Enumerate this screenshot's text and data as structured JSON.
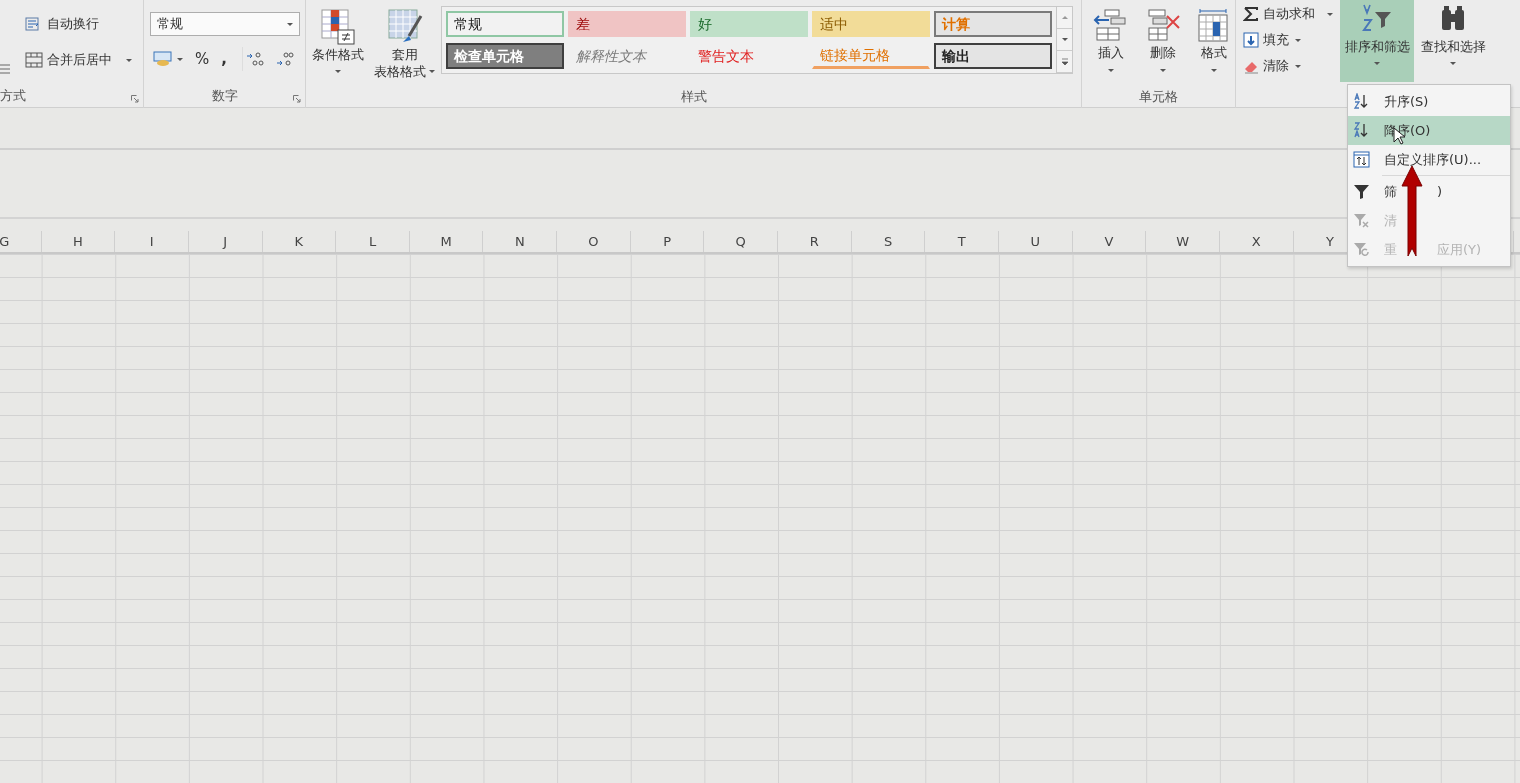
{
  "alignment_group": {
    "label": "方式",
    "wrap_text": "自动换行",
    "merge_center": "合并后居中"
  },
  "number_group": {
    "label": "数字",
    "format_value": "常规",
    "percent": "%",
    "comma": ","
  },
  "styles_group": {
    "label": "样式",
    "conditional_format": "条件格式",
    "table_format": [
      "套用",
      "表格格式"
    ],
    "gallery": [
      {
        "label": "常规",
        "kind": "normal",
        "selected": true
      },
      {
        "label": "差",
        "kind": "bad",
        "selected": false
      },
      {
        "label": "好",
        "kind": "good",
        "selected": false
      },
      {
        "label": "适中",
        "kind": "neutral",
        "selected": false
      },
      {
        "label": "计算",
        "kind": "calculation",
        "selected": false
      },
      {
        "label": "检查单元格",
        "kind": "check",
        "selected": false
      },
      {
        "label": "解释性文本",
        "kind": "explanatory",
        "selected": false
      },
      {
        "label": "警告文本",
        "kind": "warning",
        "selected": false
      },
      {
        "label": "链接单元格",
        "kind": "linked",
        "selected": false
      },
      {
        "label": "输出",
        "kind": "output",
        "selected": false
      }
    ]
  },
  "cells_group": {
    "label": "单元格",
    "buttons": [
      "插入",
      "删除",
      "格式"
    ]
  },
  "editing_group": {
    "small_buttons": [
      "自动求和",
      "填充",
      "清除"
    ],
    "sort_filter": {
      "label": "排序和筛选",
      "expanded": true
    },
    "find_select": "查找和选择"
  },
  "column_headers": [
    "G",
    "H",
    "I",
    "J",
    "K",
    "L",
    "M",
    "N",
    "O",
    "P",
    "Q",
    "R",
    "S",
    "T",
    "U",
    "V",
    "W",
    "X",
    "Y"
  ],
  "sort_menu": {
    "items": [
      {
        "label": "升序(S)",
        "selected": false,
        "disabled": false
      },
      {
        "label": "降序(O)",
        "selected": true,
        "disabled": false
      },
      {
        "label": "自定义排序(U)...",
        "selected": false,
        "disabled": false
      },
      {
        "label": "筛",
        "label_after": ")",
        "selected": false,
        "disabled": false
      },
      {
        "label": "清",
        "selected": false,
        "disabled": true
      },
      {
        "label": "重",
        "label_after": "应用(Y)",
        "selected": false,
        "disabled": true
      }
    ]
  }
}
